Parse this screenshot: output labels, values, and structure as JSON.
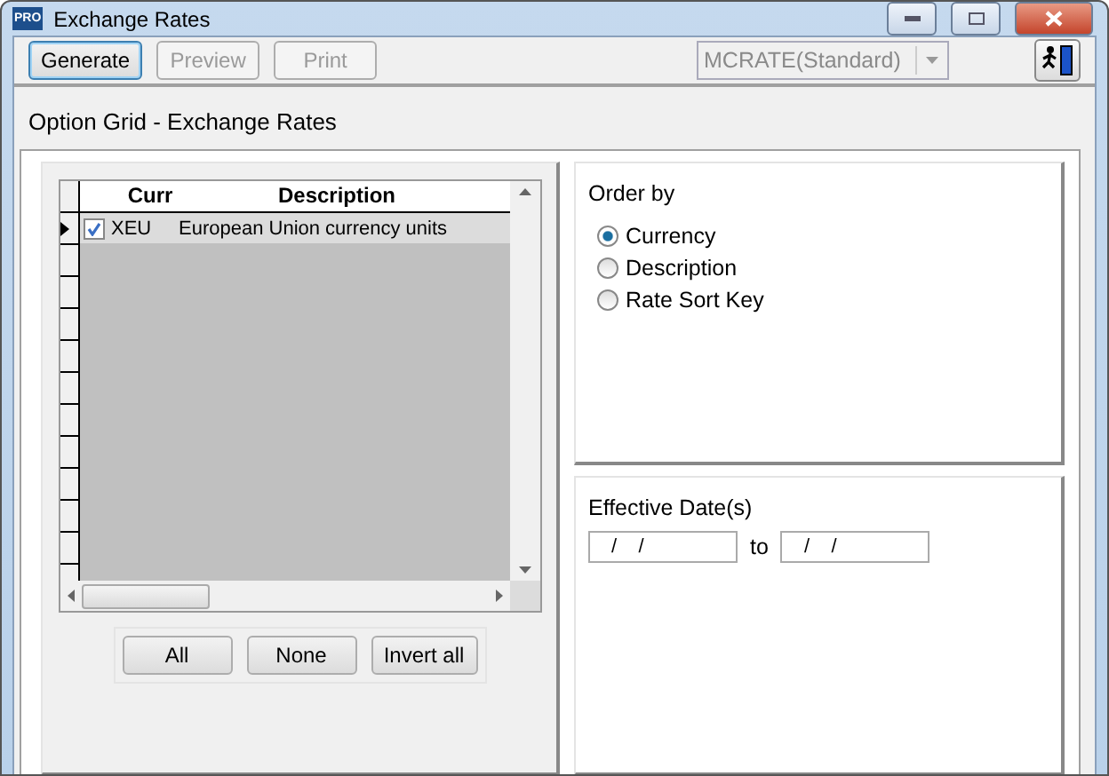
{
  "window": {
    "title": "Exchange Rates",
    "app_badge": "PRO"
  },
  "toolbar": {
    "buttons": [
      {
        "label": "Generate",
        "disabled": false,
        "focused": true
      },
      {
        "label": "Preview",
        "disabled": true,
        "focused": false
      },
      {
        "label": "Print",
        "disabled": true,
        "focused": false
      }
    ],
    "report_select": {
      "value": "MCRATE(Standard)",
      "disabled": true
    }
  },
  "heading": "Option Grid - Exchange Rates",
  "grid": {
    "columns": [
      "Curr",
      "Description"
    ],
    "rows": [
      {
        "current": true,
        "checked": true,
        "curr": "XEU",
        "description": "European Union currency units"
      }
    ],
    "buttons": [
      "All",
      "None",
      "Invert all"
    ]
  },
  "order_by": {
    "title": "Order by",
    "options": [
      {
        "label": "Currency",
        "selected": true
      },
      {
        "label": "Description",
        "selected": false
      },
      {
        "label": "Rate Sort Key",
        "selected": false
      }
    ]
  },
  "dates": {
    "title": "Effective Date(s)",
    "from": "/    /",
    "separator": "to",
    "to": "/    /"
  }
}
